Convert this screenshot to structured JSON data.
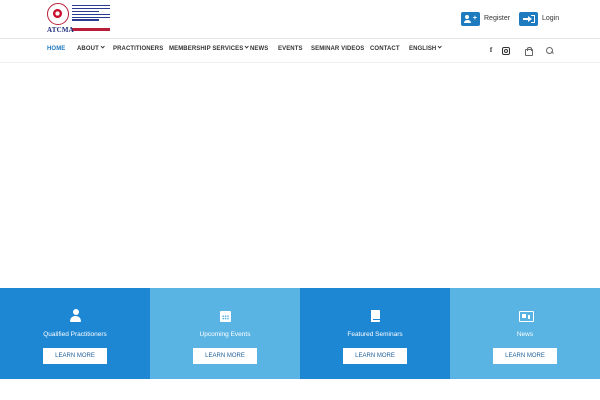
{
  "header": {
    "logo_text": "ATCMA",
    "register_label": "Register",
    "login_label": "Login"
  },
  "nav": {
    "items": [
      {
        "label": "HOME",
        "active": true,
        "dropdown": false
      },
      {
        "label": "ABOUT",
        "active": false,
        "dropdown": true
      },
      {
        "label": "PRACTITIONERS",
        "active": false,
        "dropdown": false
      },
      {
        "label": "MEMBERSHIP SERVICES",
        "active": false,
        "dropdown": true
      },
      {
        "label": "NEWS",
        "active": false,
        "dropdown": false
      },
      {
        "label": "EVENTS",
        "active": false,
        "dropdown": false
      },
      {
        "label": "SEMINAR VIDEOS",
        "active": false,
        "dropdown": false
      },
      {
        "label": "CONTACT",
        "active": false,
        "dropdown": false
      },
      {
        "label": "ENGLISH",
        "active": false,
        "dropdown": true
      }
    ],
    "social_icons": [
      "facebook-icon",
      "instagram-icon"
    ],
    "utility_icons": [
      "shopping-bag-icon",
      "search-icon"
    ]
  },
  "features": [
    {
      "icon": "doctor-icon",
      "label": "Qualified Practitioners",
      "button": "LEARN MORE",
      "color": "#1e87d4"
    },
    {
      "icon": "calendar-icon",
      "label": "Upcoming Events",
      "button": "LEARN MORE",
      "color": "#59b4e3"
    },
    {
      "icon": "book-icon",
      "label": "Featured Seminars",
      "button": "LEARN MORE",
      "color": "#1e87d4"
    },
    {
      "icon": "newspaper-icon",
      "label": "News",
      "button": "LEARN MORE",
      "color": "#59b4e3"
    }
  ],
  "colors": {
    "accent": "#1f7bbf",
    "feature_dark": "#1e87d4",
    "feature_light": "#59b4e3"
  }
}
